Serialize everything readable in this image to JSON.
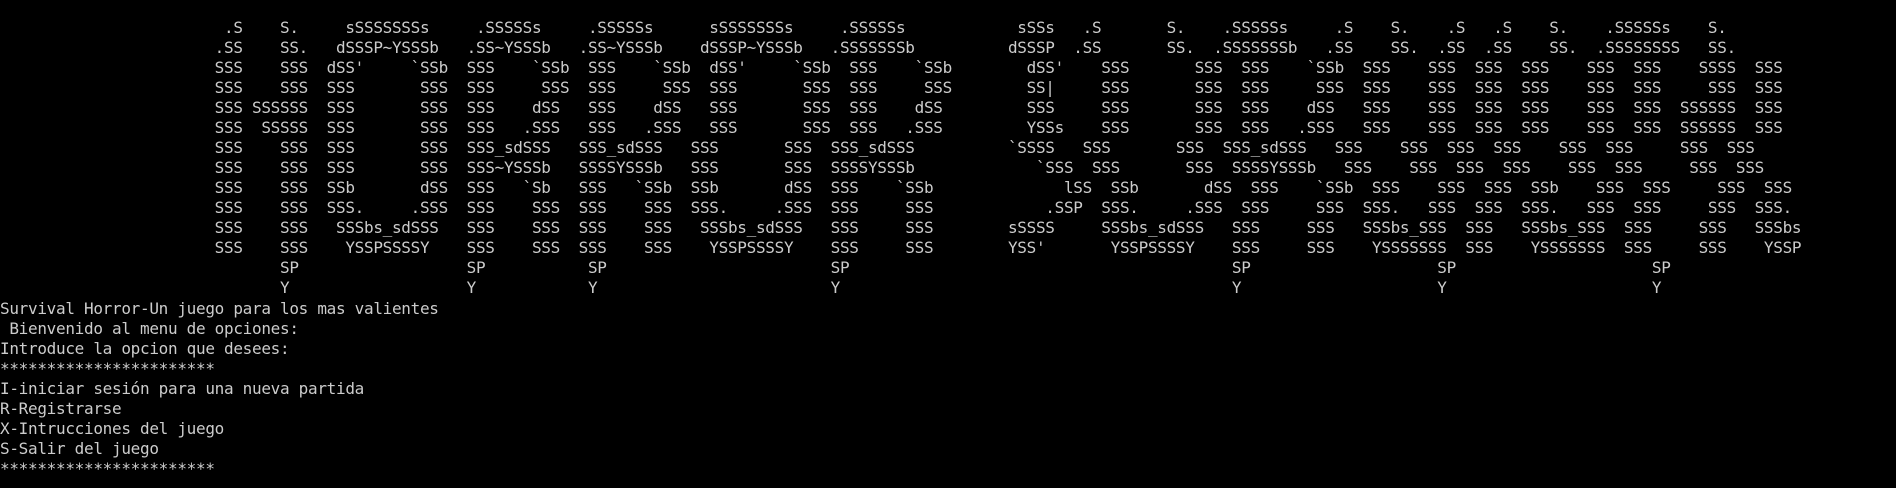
{
  "colors": {
    "background": "#000000",
    "foreground": "#cccccc"
  },
  "banner": {
    "lines": [
      "                        .S    S.     sSSSSSSSs     .SSSSSs     .SSSSSs      sSSSSSSSs     .SSSSSs            sSSs   .S       S.    .SSSSSs     .S    S.    .S   .S    S.    .SSSSSs    S.",
      "                       .SS    SS.   dSSSP~YSSSb   .SS~YSSSb   .SS~YSSSb    dSSSP~YSSSb   .SSSSSSSb          dSSSP  .SS       SS.  .SSSSSSSb   .SS    SS.  .SS  .SS    SS.  .SSSSSSSS   SS.",
      "                       SSS    SSS  dSS'     `SSb  SSS    `SSb  SSS    `SSb  dSS'     `SSb  SSS    `SSb        dSS'    SSS       SSS  SSS    `SSb  SSS    SSS  SSS  SSS    SSS  SSS    SSSS  SSS",
      "                       SSS    SSS  SSS       SSS  SSS     SSS  SSS     SSS  SSS       SSS  SSS     SSS        SS|     SSS       SSS  SSS     SSS  SSS    SSS  SSS  SSS    SSS  SSS     SSS  SSS",
      "                       SSS SSSSSS  SSS       SSS  SSS    dSS   SSS    dSS   SSS       SSS  SSS    dSS         SSS     SSS       SSS  SSS    dSS   SSS    SSS  SSS  SSS    SSS  SSS  SSSSSS  SSS",
      "                       SSS  SSSSS  SSS       SSS  SSS   .SSS   SSS   .SSS   SSS       SSS  SSS   .SSS         YSSs    SSS       SSS  SSS   .SSS   SSS    SSS  SSS  SSS    SSS  SSS  SSSSSS  SSS",
      "                       SSS    SSS  SSS       SSS  SSS_sdSSS   SSS_sdSSS   SSS       SSS  SSS_sdSSS          `SSSS   SSS       SSS  SSS_sdSSS   SSS    SSS  SSS  SSS    SSS  SSS     SSS  SSS",
      "                       SSS    SSS  SSS       SSS  SSS~YSSSb   SSSSYSSSb   SSS       SSS  SSSSYSSSb             `SSS  SSS       SSS  SSSSYSSSb   SSS    SSS  SSS  SSS    SSS  SSS     SSS  SSS",
      "                       SSS    SSS  SSb       dSS  SSS   `Sb   SSS   `SSb  SSb       dSS  SSS    `SSb              lSS  SSb       dSS  SSS    `SSb  SSS    SSS  SSS  SSb    SSS  SSS     SSS  SSS",
      "                       SSS    SSS  SSS.     .SSS  SSS    SSS  SSS    SSS  SSS.     .SSS  SSS     SSS            .SSP  SSS.     .SSS  SSS     SSS  SSS.   SSS  SSS  SSS.   SSS  SSS     SSS  SSS.",
      "                       SSS    SSS   SSSbs_sdSSS   SSS    SSS  SSS    SSS   SSSbs_sdSSS   SSS     SSS        sSSSS     SSSbs_sdSSS   SSS     SSS   SSSbs_SSS  SSS   SSSbs_SSS  SSS     SSS   SSSbs",
      "                       SSS    SSS    YSSPSSSSY    SSS    SSS  SSS    SSS    YSSPSSSSY    SSS     SSS        YSS'       YSSPSSSSY    SSS     SSS    YSSSSSSS  SSS    YSSSSSSS  SSS     SSS    YSSP",
      "                              SP                  SP           SP                        SP                                         SP                    SP                     SP",
      "                              Y                   Y            Y                         Y                                          Y                     Y                      Y"
    ]
  },
  "intro": {
    "title": "Survival Horror-Un juego para los mas valientes",
    "welcome": " Bienvenido al menu de opciones:",
    "prompt": "Introduce la opcion que desees:",
    "separator_top": "***********************"
  },
  "menu": {
    "options": [
      "I-iniciar sesión para una nueva partida",
      "R-Registrarse",
      "X-Intrucciones del juego",
      "S-Salir del juego"
    ],
    "separator_bottom": "***********************"
  }
}
